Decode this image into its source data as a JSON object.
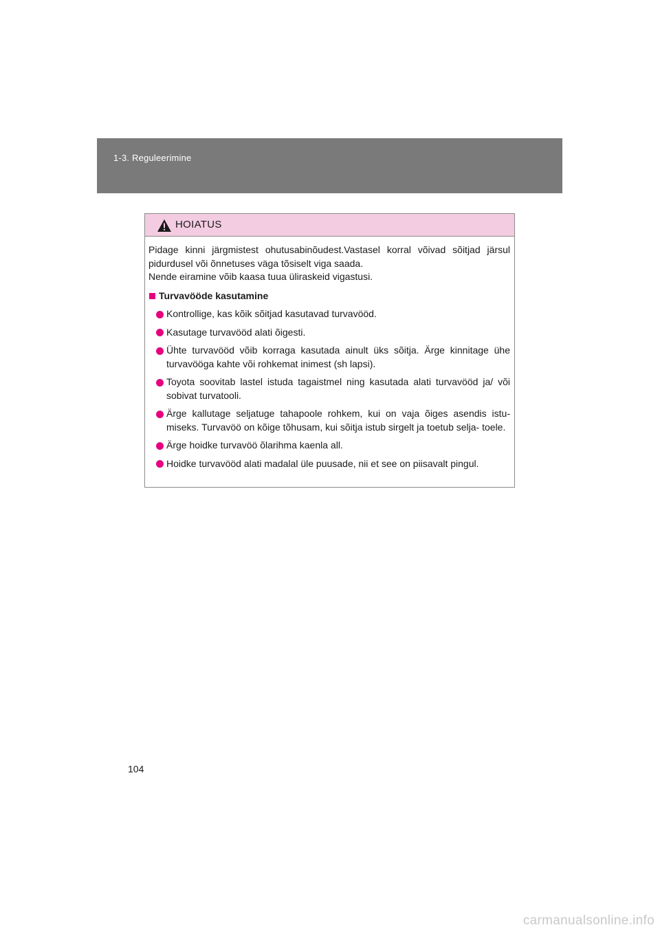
{
  "header": {
    "section": "1-3. Reguleerimine"
  },
  "warning": {
    "title": "HOIATUS",
    "icon": "warning-triangle-icon",
    "intro": [
      "Pidage kinni järgmistest ohutusabinõudest.Vastasel korral võivad sõitjad järsul",
      "pidurdusel või õnnetuses väga tõsiselt viga saada.",
      "Nende eiramine võib kaasa tuua üliraskeid vigastusi."
    ],
    "subheading": "Turvavööde kasutamine",
    "items": [
      "Kontrollige, kas kõik sõitjad kasutavad turvavööd.",
      "Kasutage turvavööd alati õigesti.",
      "Ühte turvavööd võib korraga kasutada ainult üks sõitja. Ärge kinnitage ühe turvavööga kahte või rohkemat inimest (sh lapsi).",
      "Toyota soovitab lastel istuda tagaistmel ning kasutada alati turvavööd ja/ või sobivat turvatooli.",
      "Ärge kallutage seljatuge tahapoole rohkem, kui on vaja õiges asendis istu- miseks. Turvavöö on kõige tõhusam, kui sõitja istub sirgelt ja toetub selja- toele.",
      "Ärge hoidke turvavöö õlarihma kaenla all.",
      "Hoidke turvavööd alati madalal üle puusade, nii et see on piisavalt pingul."
    ]
  },
  "page_number": "104",
  "watermark": "carmanualsonline.info",
  "colors": {
    "header_bar": "#7a7a7a",
    "warning_header": "#f4cce2",
    "bullet": "#e6007e"
  }
}
